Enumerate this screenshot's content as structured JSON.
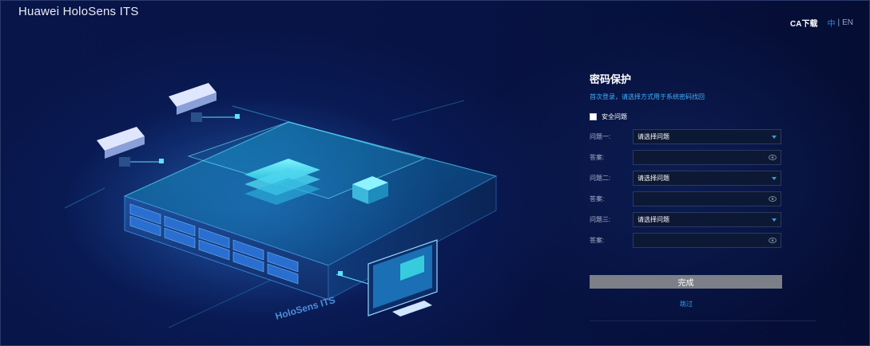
{
  "app": {
    "title": "Huawei HoloSens ITS"
  },
  "header": {
    "ca_download": "CA下载",
    "lang_zh": "中",
    "lang_sep": "|",
    "lang_en": "EN"
  },
  "illustration": {
    "brand_text": "HoloSens ITS"
  },
  "panel": {
    "title": "密码保护",
    "subtitle": "首次登录，请选择方式用于系统密码找回",
    "security_question_label": "安全问题",
    "rows": [
      {
        "label": "问题一:",
        "type": "select",
        "value": "请选择问题"
      },
      {
        "label": "答案:",
        "type": "password",
        "value": ""
      },
      {
        "label": "问题二:",
        "type": "select",
        "value": "请选择问题"
      },
      {
        "label": "答案:",
        "type": "password",
        "value": ""
      },
      {
        "label": "问题三:",
        "type": "select",
        "value": "请选择问题"
      },
      {
        "label": "答案:",
        "type": "password",
        "value": ""
      }
    ],
    "submit_label": "完成",
    "skip_label": "跳过"
  },
  "colors": {
    "accent": "#1e8cff",
    "link": "#2f9ee8",
    "button": "#7c7f87",
    "background": "#06103a"
  }
}
